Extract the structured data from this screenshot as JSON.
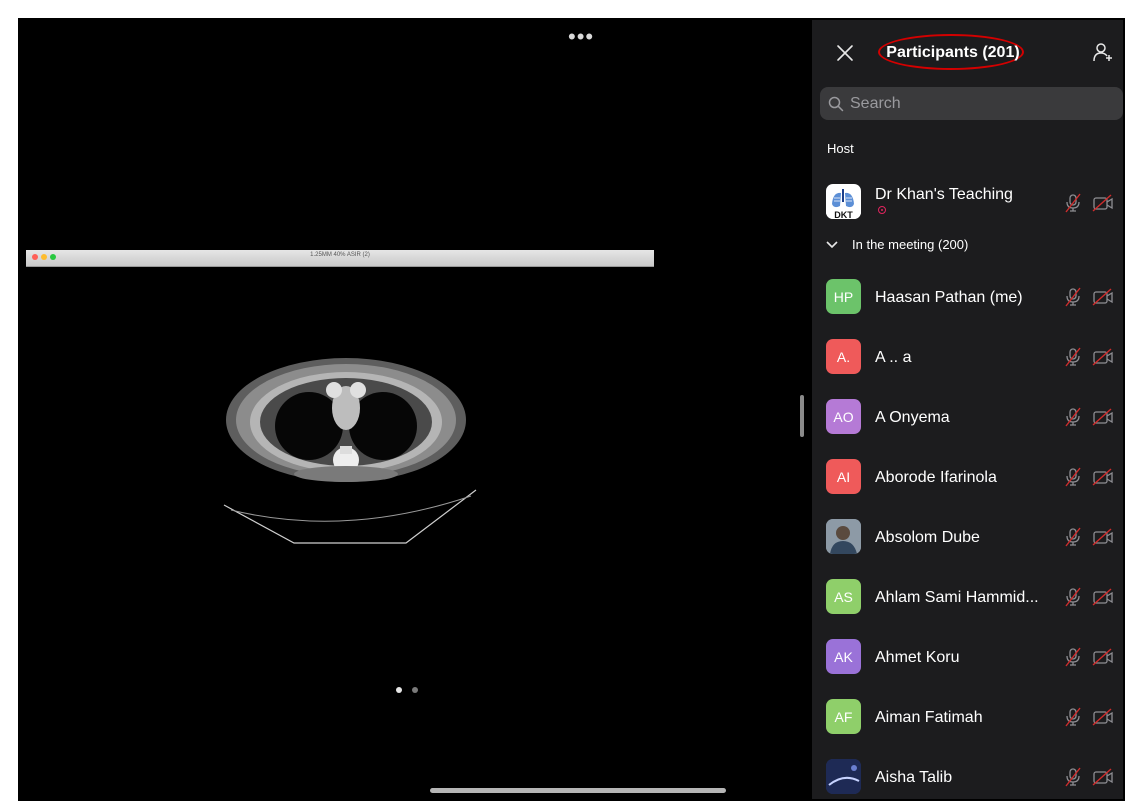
{
  "meeting": {
    "viewer_window_title": "1.25MM 40% ASIR (2)"
  },
  "panel": {
    "title": "Participants (201)",
    "search_placeholder": "Search",
    "host_label": "Host",
    "host": {
      "name": "Dr Khan's Teaching",
      "avatar_text": "DKT"
    },
    "section_label": "In the meeting (200)",
    "participants": [
      {
        "name": "Haasan Pathan (me)",
        "initials": "HP",
        "color": "#6cc36a"
      },
      {
        "name": "A .. a",
        "initials": "A.",
        "color": "#ef5a5a"
      },
      {
        "name": "A Onyema",
        "initials": "AO",
        "color": "#b57ad6"
      },
      {
        "name": "Aborode Ifarinola",
        "initials": "AI",
        "color": "#ef5a5a"
      },
      {
        "name": "Absolom Dube",
        "initials": "",
        "color": "#6b7a89"
      },
      {
        "name": "Ahlam Sami Hammid...",
        "initials": "AS",
        "color": "#8fcf6a"
      },
      {
        "name": "Ahmet Koru",
        "initials": "AK",
        "color": "#9a72d8"
      },
      {
        "name": "Aiman Fatimah",
        "initials": "AF",
        "color": "#8fcf6a"
      },
      {
        "name": "Aisha Talib",
        "initials": "",
        "color": "#2b3a6b"
      }
    ]
  },
  "colors": {
    "panel_bg": "#1c1c1e",
    "muted_red": "#d02c2c",
    "accent_circle": "#d40000"
  },
  "icons": [
    "close-icon",
    "add-participant-icon",
    "search-icon",
    "chevron-down-icon",
    "mic-muted-icon",
    "camera-off-icon",
    "more-icon"
  ]
}
